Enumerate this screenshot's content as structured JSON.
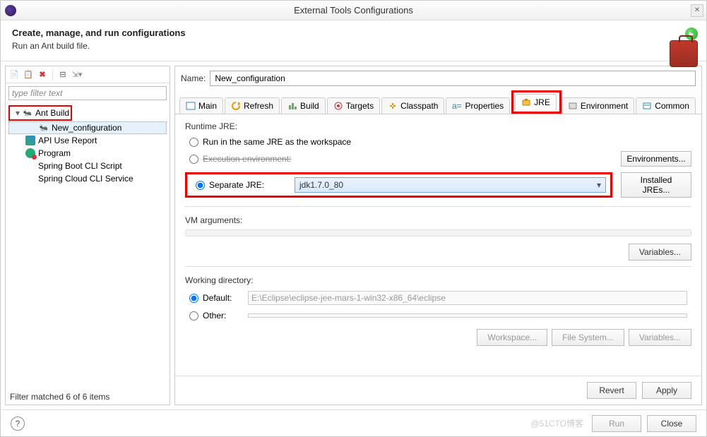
{
  "window": {
    "title": "External Tools Configurations"
  },
  "header": {
    "title": "Create, manage, and run configurations",
    "subtitle": "Run an Ant build file."
  },
  "left": {
    "filter_placeholder": "type filter text",
    "tree": {
      "antBuild": "Ant Build",
      "newConfig": "New_configuration",
      "apiUse": "API Use Report",
      "program": "Program",
      "springBoot": "Spring Boot CLI Script",
      "springCloud": "Spring Cloud CLI Service"
    },
    "filter_status": "Filter matched 6 of 6 items"
  },
  "right": {
    "name_label": "Name:",
    "name_value": "New_configuration",
    "tabs": {
      "main": "Main",
      "refresh": "Refresh",
      "build": "Build",
      "targets": "Targets",
      "classpath": "Classpath",
      "properties": "Properties",
      "jre": "JRE",
      "environment": "Environment",
      "common": "Common"
    },
    "jre": {
      "runtime_title": "Runtime JRE:",
      "same_jre": "Run in the same JRE as the workspace",
      "exec_env": "Execution environment:",
      "separate": "Separate JRE:",
      "separate_value": "jdk1.7.0_80",
      "environments_btn": "Environments...",
      "installed_btn": "Installed JREs...",
      "vm_title": "VM arguments:",
      "variables_btn": "Variables...",
      "wd_title": "Working directory:",
      "wd_default_label": "Default:",
      "wd_default_value": "E:\\Eclipse\\eclipse-jee-mars-1-win32-x86_64\\eclipse",
      "wd_other_label": "Other:",
      "workspace_btn": "Workspace...",
      "filesystem_btn": "File System...",
      "variables2_btn": "Variables..."
    },
    "revert": "Revert",
    "apply": "Apply"
  },
  "footer": {
    "run": "Run",
    "close": "Close",
    "watermark": "@51CTO博客"
  }
}
